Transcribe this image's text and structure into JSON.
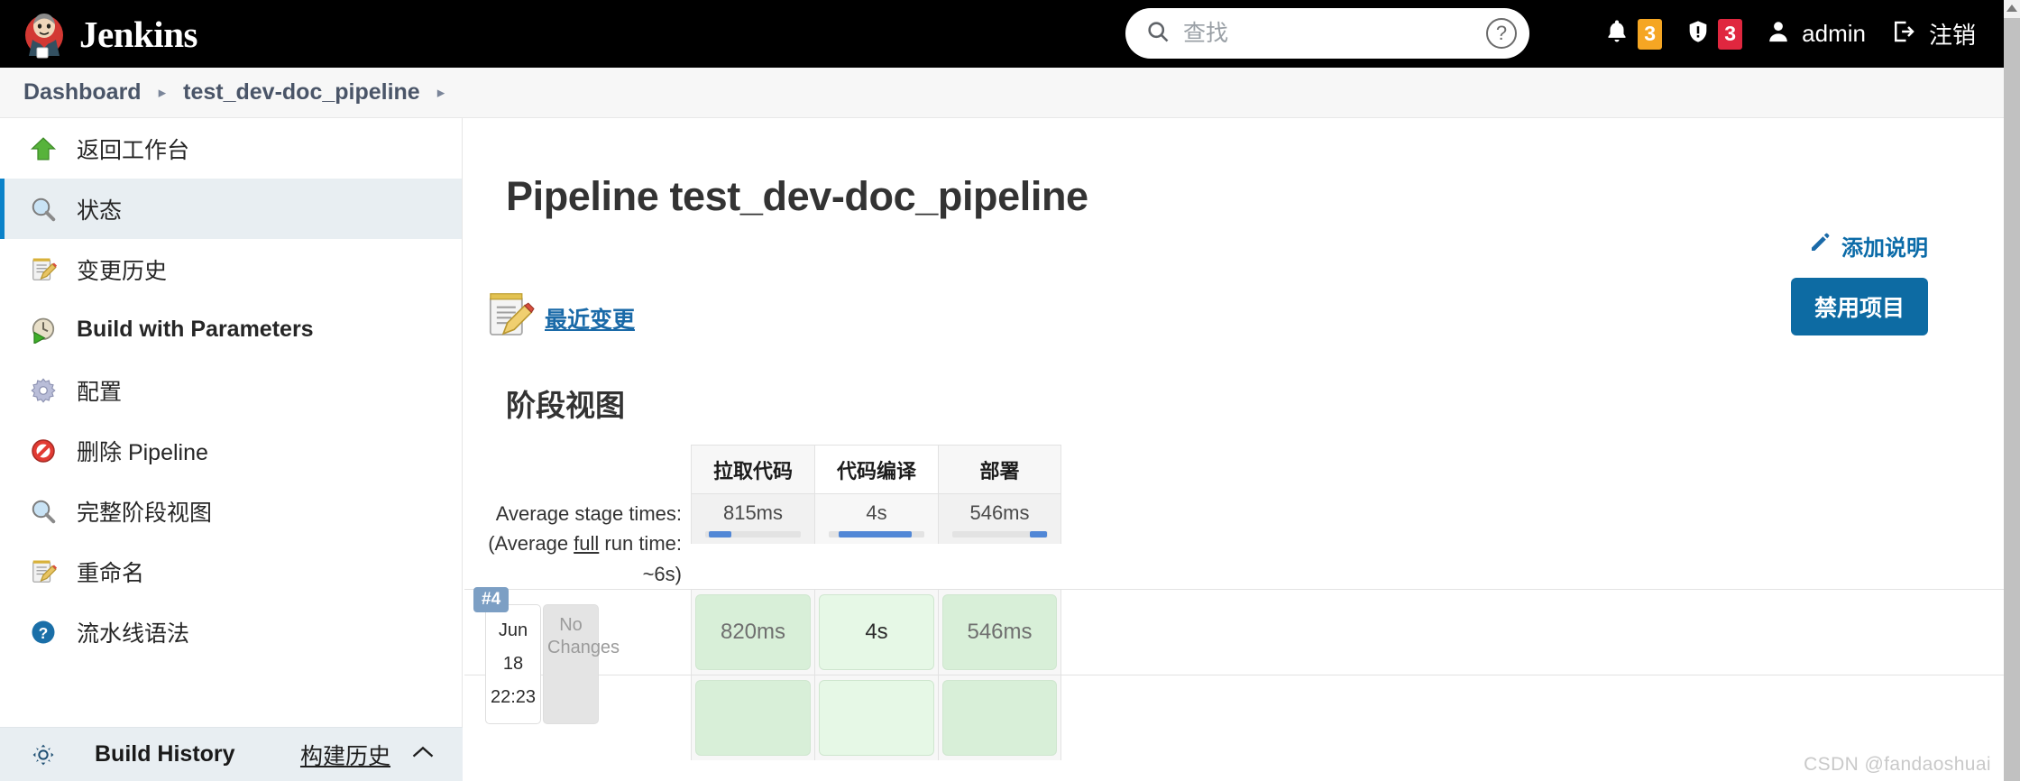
{
  "header": {
    "brand": "Jenkins",
    "search": {
      "placeholder": "查找",
      "value": ""
    },
    "help_icon": "help-circle-icon",
    "notifications": {
      "icon": "bell-icon",
      "count": "3",
      "color": "#f5a623"
    },
    "security": {
      "icon": "shield-warning-icon",
      "count": "3",
      "color": "#e0273f"
    },
    "user": {
      "icon": "person-icon",
      "label": "admin"
    },
    "logout": {
      "icon": "logout-icon",
      "label": "注销"
    }
  },
  "breadcrumb": {
    "items": [
      "Dashboard",
      "test_dev-doc_pipeline"
    ],
    "separator": "▸",
    "trailing_separator": "▸"
  },
  "sidebar": {
    "items": [
      {
        "label": "返回工作台",
        "icon": "up-arrow-icon",
        "active": false
      },
      {
        "label": "状态",
        "icon": "magnifier-icon",
        "active": true
      },
      {
        "label": "变更历史",
        "icon": "notepad-pencil-icon",
        "active": false
      },
      {
        "label": "Build with Parameters",
        "icon": "clock-play-icon",
        "active": false
      },
      {
        "label": "配置",
        "icon": "gear-icon",
        "active": false
      },
      {
        "label": "删除 Pipeline",
        "icon": "prohibited-icon",
        "active": false
      },
      {
        "label": "完整阶段视图",
        "icon": "magnifier-icon",
        "active": false
      },
      {
        "label": "重命名",
        "icon": "notepad-pencil-icon",
        "active": false
      },
      {
        "label": "流水线语法",
        "icon": "help-blue-icon",
        "active": false
      }
    ],
    "build_history": {
      "icon": "build-history-icon",
      "title": "Build History",
      "link": "构建历史",
      "chevron": "chevron-up-icon"
    }
  },
  "main": {
    "page_title": "Pipeline test_dev-doc_pipeline",
    "add_description": {
      "icon": "pencil-icon",
      "label": "添加说明"
    },
    "disable_button": "禁用项目",
    "recent_changes": {
      "icon": "notepad-pencil-icon",
      "label": "最近变更"
    },
    "stage_view_title": "阶段视图",
    "average_label": "Average stage times:",
    "average_run_prefix": "(Average ",
    "average_run_underline": "full",
    "average_run_suffix": " run time: ~6s)"
  },
  "chart_data": {
    "type": "table",
    "title": "阶段视图",
    "stages": [
      "拉取代码",
      "代码编译",
      "部署"
    ],
    "average_times": [
      "815ms",
      "4s",
      "546ms"
    ],
    "average_bar_pct": [
      23,
      77,
      18
    ],
    "average_bar_offset_pct": [
      4,
      10,
      82
    ],
    "highlighted_stage_index": 1,
    "average_full_run_time": "~6s",
    "builds": [
      {
        "number": "#4",
        "date": "Jun 18",
        "time": "22:23",
        "changes": "No Changes",
        "cells": [
          "820ms",
          "4s",
          "546ms"
        ],
        "status": "success",
        "highlighted_cell_index": 1
      },
      {
        "number": "",
        "date": "",
        "time": "",
        "changes": "",
        "cells": [
          "",
          "",
          ""
        ],
        "status": "success",
        "highlighted_cell_index": -1
      }
    ]
  },
  "watermark": "CSDN @fandaoshuai",
  "colors": {
    "accent": "#0d6ba3",
    "topbar": "#000000",
    "success_cell": "#d8efd8",
    "bar_fill": "#5187d6"
  }
}
